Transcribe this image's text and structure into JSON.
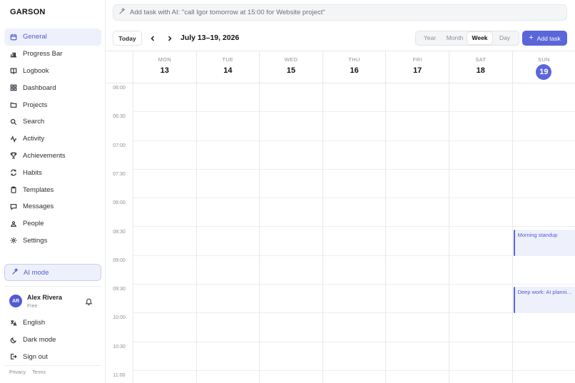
{
  "app": {
    "brand": "GARSON"
  },
  "sidebar": {
    "items": [
      {
        "label": "General",
        "icon": "calendar-icon",
        "active": true
      },
      {
        "label": "Progress Bar",
        "icon": "bar-chart-icon"
      },
      {
        "label": "Logbook",
        "icon": "book-icon"
      },
      {
        "label": "Dashboard",
        "icon": "grid-icon"
      },
      {
        "label": "Projects",
        "icon": "folder-icon"
      },
      {
        "label": "Search",
        "icon": "search-icon"
      },
      {
        "label": "Activity",
        "icon": "activity-icon"
      },
      {
        "label": "Achievements",
        "icon": "trophy-icon"
      },
      {
        "label": "Habits",
        "icon": "repeat-icon"
      },
      {
        "label": "Templates",
        "icon": "clipboard-icon"
      },
      {
        "label": "Messages",
        "icon": "message-icon"
      },
      {
        "label": "People",
        "icon": "people-icon"
      },
      {
        "label": "Settings",
        "icon": "gear-icon"
      }
    ],
    "ai_mode": "AI mode",
    "user": {
      "initials": "AR",
      "name": "Alex Rivera",
      "plan": "Free"
    },
    "bottom": [
      {
        "label": "English",
        "icon": "translate-icon"
      },
      {
        "label": "Dark mode",
        "icon": "moon-icon"
      },
      {
        "label": "Sign out",
        "icon": "sign-out-icon"
      }
    ],
    "footer": {
      "privacy": "Privacy",
      "terms": "Terms"
    }
  },
  "topbar": {
    "placeholder": "Add task with AI: \"call Igor tomorrow at 15:00 for Website project\""
  },
  "toolbar": {
    "today": "Today",
    "range": "July 13–19, 2026",
    "views": [
      "Year",
      "Month",
      "Week",
      "Day"
    ],
    "active_view": "Week",
    "add_task": "Add task"
  },
  "calendar": {
    "days": [
      {
        "dow": "MON",
        "num": "13"
      },
      {
        "dow": "TUE",
        "num": "14"
      },
      {
        "dow": "WED",
        "num": "15"
      },
      {
        "dow": "THU",
        "num": "16"
      },
      {
        "dow": "FRI",
        "num": "17"
      },
      {
        "dow": "SAT",
        "num": "18"
      },
      {
        "dow": "SUN",
        "num": "19",
        "today": true
      }
    ],
    "times": [
      "06:00",
      "06:30",
      "07:00",
      "07:30",
      "08:00",
      "08:30",
      "09:00",
      "09:30",
      "10:00",
      "10:30",
      "11:00"
    ],
    "events": [
      {
        "title": "Morning standup",
        "day": 6,
        "start": "08:30",
        "end": "09:00"
      },
      {
        "title": "Deep work: AI planning",
        "day": 6,
        "start": "09:30",
        "end": "10:00"
      }
    ],
    "accent": "#5b66d9"
  }
}
